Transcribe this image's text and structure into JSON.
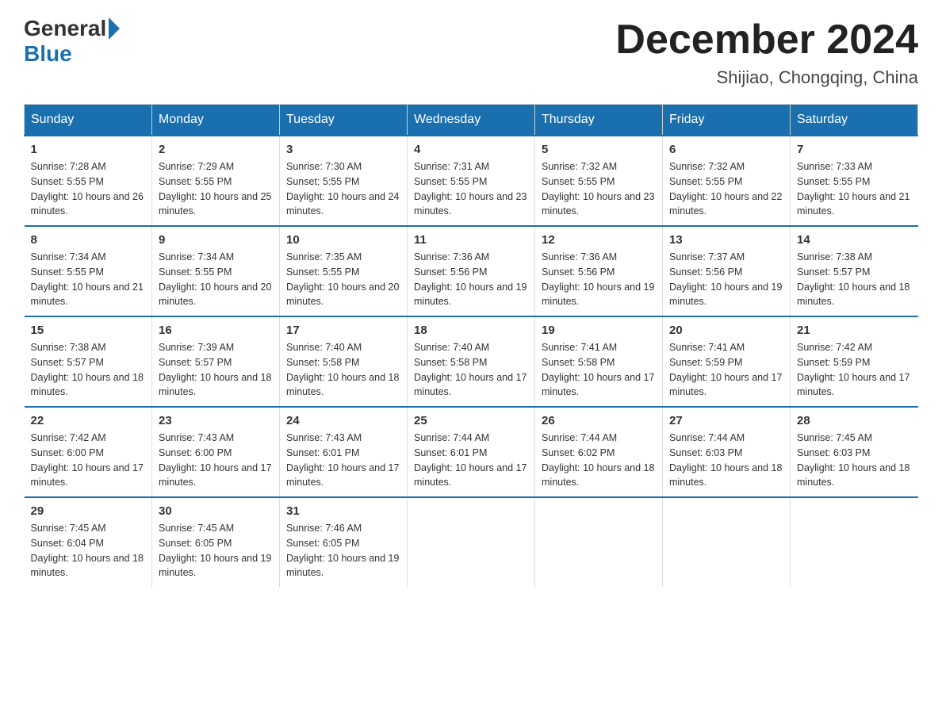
{
  "header": {
    "logo": {
      "general": "General",
      "blue": "Blue"
    },
    "title": "December 2024",
    "subtitle": "Shijiao, Chongqing, China"
  },
  "columns": [
    "Sunday",
    "Monday",
    "Tuesday",
    "Wednesday",
    "Thursday",
    "Friday",
    "Saturday"
  ],
  "weeks": [
    [
      {
        "day": "1",
        "sunrise": "7:28 AM",
        "sunset": "5:55 PM",
        "daylight": "10 hours and 26 minutes."
      },
      {
        "day": "2",
        "sunrise": "7:29 AM",
        "sunset": "5:55 PM",
        "daylight": "10 hours and 25 minutes."
      },
      {
        "day": "3",
        "sunrise": "7:30 AM",
        "sunset": "5:55 PM",
        "daylight": "10 hours and 24 minutes."
      },
      {
        "day": "4",
        "sunrise": "7:31 AM",
        "sunset": "5:55 PM",
        "daylight": "10 hours and 23 minutes."
      },
      {
        "day": "5",
        "sunrise": "7:32 AM",
        "sunset": "5:55 PM",
        "daylight": "10 hours and 23 minutes."
      },
      {
        "day": "6",
        "sunrise": "7:32 AM",
        "sunset": "5:55 PM",
        "daylight": "10 hours and 22 minutes."
      },
      {
        "day": "7",
        "sunrise": "7:33 AM",
        "sunset": "5:55 PM",
        "daylight": "10 hours and 21 minutes."
      }
    ],
    [
      {
        "day": "8",
        "sunrise": "7:34 AM",
        "sunset": "5:55 PM",
        "daylight": "10 hours and 21 minutes."
      },
      {
        "day": "9",
        "sunrise": "7:34 AM",
        "sunset": "5:55 PM",
        "daylight": "10 hours and 20 minutes."
      },
      {
        "day": "10",
        "sunrise": "7:35 AM",
        "sunset": "5:55 PM",
        "daylight": "10 hours and 20 minutes."
      },
      {
        "day": "11",
        "sunrise": "7:36 AM",
        "sunset": "5:56 PM",
        "daylight": "10 hours and 19 minutes."
      },
      {
        "day": "12",
        "sunrise": "7:36 AM",
        "sunset": "5:56 PM",
        "daylight": "10 hours and 19 minutes."
      },
      {
        "day": "13",
        "sunrise": "7:37 AM",
        "sunset": "5:56 PM",
        "daylight": "10 hours and 19 minutes."
      },
      {
        "day": "14",
        "sunrise": "7:38 AM",
        "sunset": "5:57 PM",
        "daylight": "10 hours and 18 minutes."
      }
    ],
    [
      {
        "day": "15",
        "sunrise": "7:38 AM",
        "sunset": "5:57 PM",
        "daylight": "10 hours and 18 minutes."
      },
      {
        "day": "16",
        "sunrise": "7:39 AM",
        "sunset": "5:57 PM",
        "daylight": "10 hours and 18 minutes."
      },
      {
        "day": "17",
        "sunrise": "7:40 AM",
        "sunset": "5:58 PM",
        "daylight": "10 hours and 18 minutes."
      },
      {
        "day": "18",
        "sunrise": "7:40 AM",
        "sunset": "5:58 PM",
        "daylight": "10 hours and 17 minutes."
      },
      {
        "day": "19",
        "sunrise": "7:41 AM",
        "sunset": "5:58 PM",
        "daylight": "10 hours and 17 minutes."
      },
      {
        "day": "20",
        "sunrise": "7:41 AM",
        "sunset": "5:59 PM",
        "daylight": "10 hours and 17 minutes."
      },
      {
        "day": "21",
        "sunrise": "7:42 AM",
        "sunset": "5:59 PM",
        "daylight": "10 hours and 17 minutes."
      }
    ],
    [
      {
        "day": "22",
        "sunrise": "7:42 AM",
        "sunset": "6:00 PM",
        "daylight": "10 hours and 17 minutes."
      },
      {
        "day": "23",
        "sunrise": "7:43 AM",
        "sunset": "6:00 PM",
        "daylight": "10 hours and 17 minutes."
      },
      {
        "day": "24",
        "sunrise": "7:43 AM",
        "sunset": "6:01 PM",
        "daylight": "10 hours and 17 minutes."
      },
      {
        "day": "25",
        "sunrise": "7:44 AM",
        "sunset": "6:01 PM",
        "daylight": "10 hours and 17 minutes."
      },
      {
        "day": "26",
        "sunrise": "7:44 AM",
        "sunset": "6:02 PM",
        "daylight": "10 hours and 18 minutes."
      },
      {
        "day": "27",
        "sunrise": "7:44 AM",
        "sunset": "6:03 PM",
        "daylight": "10 hours and 18 minutes."
      },
      {
        "day": "28",
        "sunrise": "7:45 AM",
        "sunset": "6:03 PM",
        "daylight": "10 hours and 18 minutes."
      }
    ],
    [
      {
        "day": "29",
        "sunrise": "7:45 AM",
        "sunset": "6:04 PM",
        "daylight": "10 hours and 18 minutes."
      },
      {
        "day": "30",
        "sunrise": "7:45 AM",
        "sunset": "6:05 PM",
        "daylight": "10 hours and 19 minutes."
      },
      {
        "day": "31",
        "sunrise": "7:46 AM",
        "sunset": "6:05 PM",
        "daylight": "10 hours and 19 minutes."
      },
      null,
      null,
      null,
      null
    ]
  ],
  "labels": {
    "sunrise": "Sunrise:",
    "sunset": "Sunset:",
    "daylight": "Daylight:"
  }
}
